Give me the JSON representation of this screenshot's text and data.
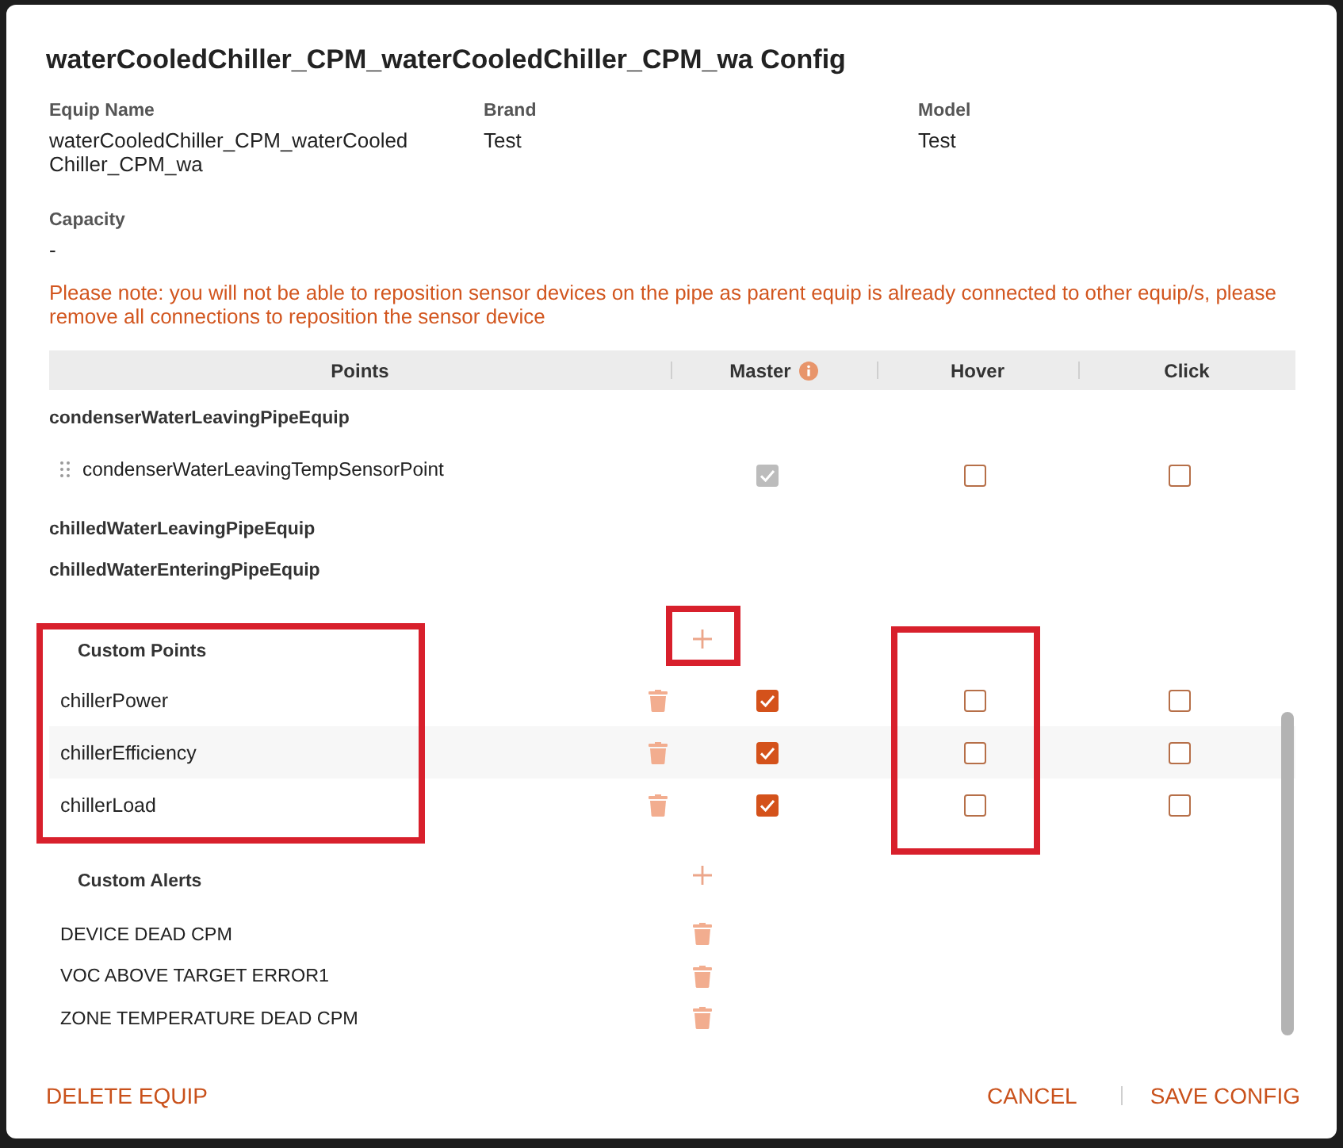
{
  "dialog": {
    "title": "waterCooledChiller_CPM_waterCooledChiller_CPM_wa Config"
  },
  "details": [
    {
      "label": "Equip Name",
      "value": "waterCooledChiller_CPM_waterCooledChiller_CPM_wa"
    },
    {
      "label": "Brand",
      "value": "Test"
    },
    {
      "label": "Model",
      "value": "Test"
    },
    {
      "label": "Capacity",
      "value": "-"
    }
  ],
  "note": "Please note: you will not be able to reposition sensor devices on the pipe as parent equip is already connected to other equip/s, please remove all connections to reposition the sensor device",
  "table": {
    "columns": [
      {
        "label": "Points",
        "info": false
      },
      {
        "label": "Master",
        "info": true
      },
      {
        "label": "Hover",
        "info": false
      },
      {
        "label": "Click",
        "info": false
      }
    ]
  },
  "point_groups": [
    {
      "name": "condenserWaterLeavingPipeEquip",
      "points": [
        {
          "name": "condenserWaterLeavingTempSensorPoint",
          "master": {
            "checked": true,
            "disabled": true
          },
          "hover": {
            "checked": false,
            "disabled": false
          },
          "click": {
            "checked": false,
            "disabled": false
          }
        }
      ]
    },
    {
      "name": "chilledWaterLeavingPipeEquip"
    },
    {
      "name": "chilledWaterEnteringPipeEquip"
    }
  ],
  "custom_points": {
    "title": "Custom Points",
    "names_highlighted": true,
    "add_highlighted": true,
    "hover_highlighted": true,
    "rows": [
      {
        "name": "chillerPower",
        "master": {
          "checked": true,
          "disabled": false
        },
        "hover": {
          "checked": false,
          "disabled": false
        },
        "click": {
          "checked": false,
          "disabled": false
        }
      },
      {
        "name": "chillerEfficiency",
        "master": {
          "checked": true,
          "disabled": false
        },
        "hover": {
          "checked": false,
          "disabled": false
        },
        "click": {
          "checked": false,
          "disabled": false
        }
      },
      {
        "name": "chillerLoad",
        "master": {
          "checked": true,
          "disabled": false
        },
        "hover": {
          "checked": false,
          "disabled": false
        },
        "click": {
          "checked": false,
          "disabled": false
        }
      }
    ]
  },
  "custom_alerts": {
    "title": "Custom Alerts",
    "items": [
      "DEVICE DEAD CPM",
      "VOC ABOVE TARGET ERROR1",
      "ZONE TEMPERATURE DEAD CPM"
    ]
  },
  "footer": {
    "delete": "DELETE EQUIP",
    "cancel": "CANCEL",
    "save": "SAVE CONFIG"
  }
}
